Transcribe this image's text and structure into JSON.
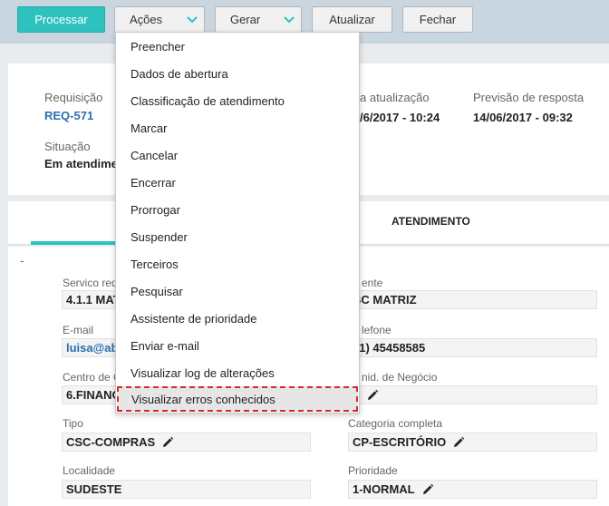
{
  "toolbar": {
    "processar": "Processar",
    "acoes": "Ações",
    "gerar": "Gerar",
    "atualizar": "Atualizar",
    "fechar": "Fechar"
  },
  "header": {
    "requisicao_label": "Requisição",
    "requisicao_value": "REQ-571",
    "ultima_atualizacao_label": "a atualização",
    "ultima_atualizacao_value": "/6/2017 - 10:24",
    "previsao_label": "Previsão de resposta",
    "previsao_value": "14/06/2017 - 09:32",
    "situacao_label": "Situação",
    "situacao_value": "Em atendime"
  },
  "tabs": {
    "atendimento": "ATENDIMENTO"
  },
  "form": {
    "collapse": "-",
    "servico_label": "Servico req",
    "servico_value": "4.1.1 MAT",
    "cliente_label": "ente",
    "cliente_value": "BC MATRIZ",
    "email_label": "E-mail",
    "email_value": "luisa@ab",
    "telefone_label": "lefone",
    "telefone_value": "51) 45458585",
    "centro_label": "Centro de C",
    "centro_value": "6.FINANC",
    "unid_label": "nid. de Negócio",
    "unid_value": "",
    "tipo_label": "Tipo",
    "tipo_value": "CSC-COMPRAS",
    "categoria_label": "Categoria completa",
    "categoria_value": "CP-ESCRITÓRIO",
    "localidade_label": "Localidade",
    "localidade_value": "SUDESTE",
    "prioridade_label": "Prioridade",
    "prioridade_value": "1-NORMAL"
  },
  "menu": {
    "items": [
      "Preencher",
      "Dados de abertura",
      "Classificação de atendimento",
      "Marcar",
      "Cancelar",
      "Encerrar",
      "Prorrogar",
      "Suspender",
      "Terceiros",
      "Pesquisar",
      "Assistente de prioridade",
      "Enviar e-mail",
      "Visualizar log de alterações",
      "Visualizar erros conhecidos"
    ]
  },
  "colors": {
    "accent": "#2ec2bf",
    "link": "#2a6fb0",
    "highlight_border": "#d42a2a",
    "toolbar_bg": "#c9d6e0"
  },
  "icons": {
    "dropdown": "chevron-down-icon",
    "edit": "pencil-icon"
  }
}
